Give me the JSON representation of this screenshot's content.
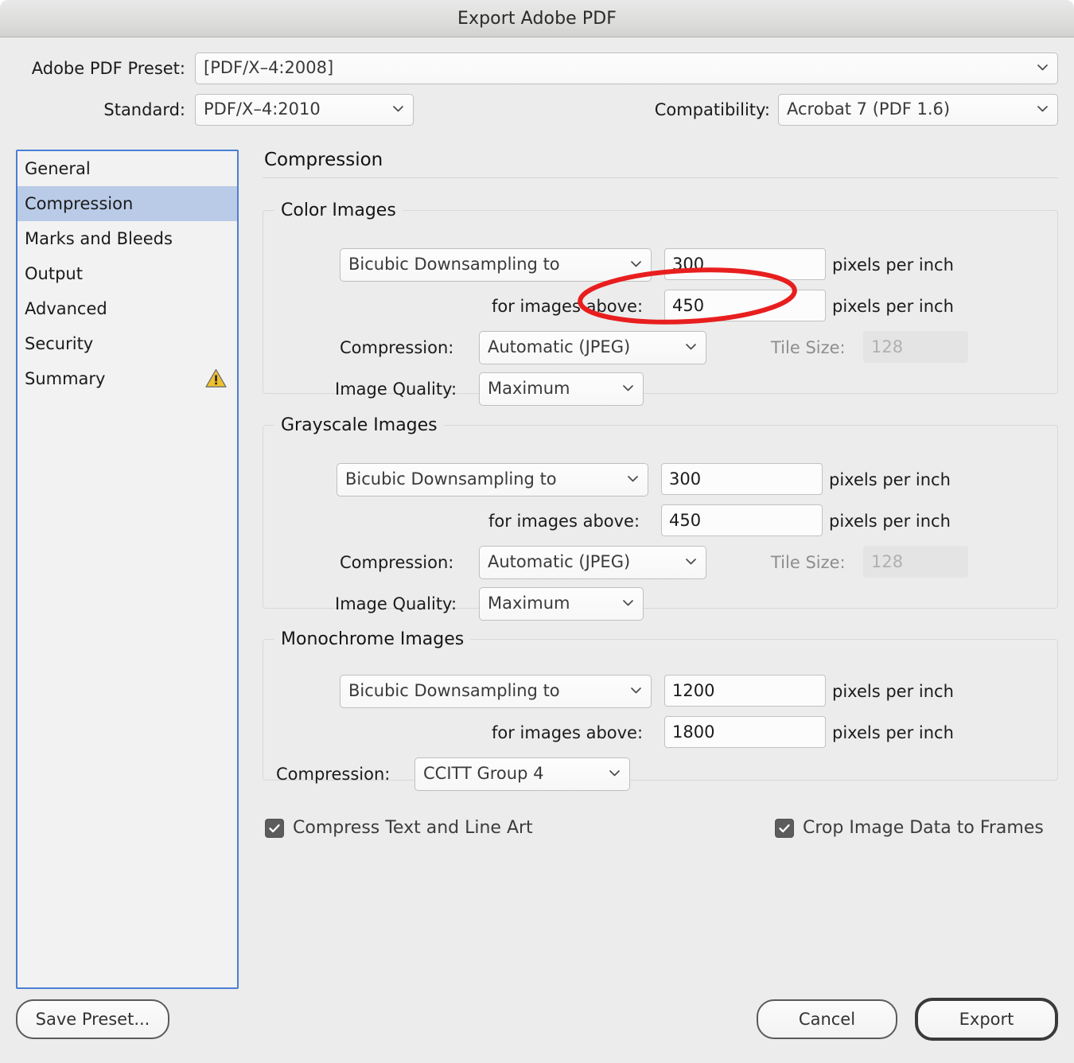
{
  "window": {
    "title": "Export Adobe PDF"
  },
  "header": {
    "preset_label": "Adobe PDF Preset:",
    "preset_value": "[PDF/X–4:2008]",
    "standard_label": "Standard:",
    "standard_value": "PDF/X–4:2010",
    "compatibility_label": "Compatibility:",
    "compatibility_value": "Acrobat 7 (PDF 1.6)"
  },
  "sidebar": {
    "items": [
      {
        "label": "General",
        "selected": false,
        "warning": false
      },
      {
        "label": "Compression",
        "selected": true,
        "warning": false
      },
      {
        "label": "Marks and Bleeds",
        "selected": false,
        "warning": false
      },
      {
        "label": "Output",
        "selected": false,
        "warning": false
      },
      {
        "label": "Advanced",
        "selected": false,
        "warning": false
      },
      {
        "label": "Security",
        "selected": false,
        "warning": false
      },
      {
        "label": "Summary",
        "selected": false,
        "warning": true
      }
    ]
  },
  "main": {
    "title": "Compression",
    "color_images": {
      "legend": "Color Images",
      "downsample_method": "Bicubic Downsampling to",
      "downsample_ppi": "300",
      "unit_1": "pixels per inch",
      "above_label": "for images above:",
      "above_ppi": "450",
      "unit_2": "pixels per inch",
      "compression_label": "Compression:",
      "compression_value": "Automatic (JPEG)",
      "tile_size_label": "Tile Size:",
      "tile_size_value": "128",
      "quality_label": "Image Quality:",
      "quality_value": "Maximum"
    },
    "grayscale_images": {
      "legend": "Grayscale Images",
      "downsample_method": "Bicubic Downsampling to",
      "downsample_ppi": "300",
      "unit_1": "pixels per inch",
      "above_label": "for images above:",
      "above_ppi": "450",
      "unit_2": "pixels per inch",
      "compression_label": "Compression:",
      "compression_value": "Automatic (JPEG)",
      "tile_size_label": "Tile Size:",
      "tile_size_value": "128",
      "quality_label": "Image Quality:",
      "quality_value": "Maximum"
    },
    "monochrome_images": {
      "legend": "Monochrome Images",
      "downsample_method": "Bicubic Downsampling to",
      "downsample_ppi": "1200",
      "unit_1": "pixels per inch",
      "above_label": "for images above:",
      "above_ppi": "1800",
      "unit_2": "pixels per inch",
      "compression_label": "Compression:",
      "compression_value": "CCITT Group 4"
    },
    "checkboxes": {
      "compress_text": "Compress Text and Line Art",
      "crop_image_data": "Crop Image Data to Frames"
    }
  },
  "footer": {
    "save_preset": "Save Preset...",
    "cancel": "Cancel",
    "export": "Export"
  },
  "annotation": {
    "type": "ellipse-highlight",
    "color": "#e81e1e",
    "targets": "color-images-for-images-above-field"
  },
  "colors": {
    "selection_blue": "#b9cbe7",
    "focus_border": "#4a7fd4",
    "warning_yellow": "#efc12e",
    "annotation_red": "#e81e1e",
    "window_bg": "#ececec"
  }
}
